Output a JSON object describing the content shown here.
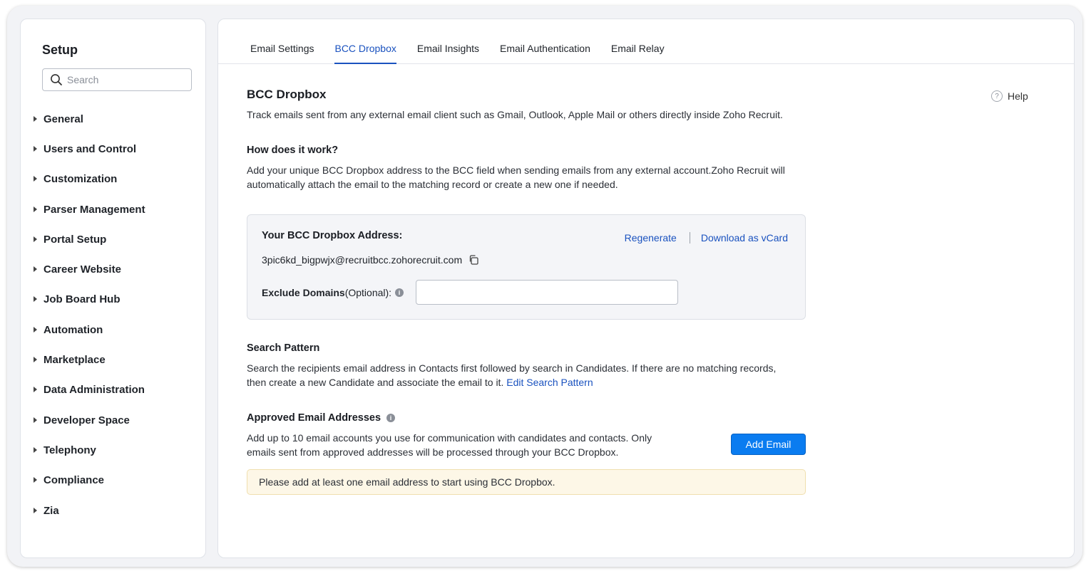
{
  "sidebar": {
    "title": "Setup",
    "search_placeholder": "Search",
    "items": [
      {
        "label": "General"
      },
      {
        "label": "Users and Control"
      },
      {
        "label": "Customization"
      },
      {
        "label": "Parser Management"
      },
      {
        "label": "Portal Setup"
      },
      {
        "label": "Career Website"
      },
      {
        "label": "Job Board Hub"
      },
      {
        "label": "Automation"
      },
      {
        "label": "Marketplace"
      },
      {
        "label": "Data Administration"
      },
      {
        "label": "Developer Space"
      },
      {
        "label": "Telephony"
      },
      {
        "label": "Compliance"
      },
      {
        "label": "Zia"
      }
    ]
  },
  "tabs": [
    {
      "label": "Email Settings",
      "active": false
    },
    {
      "label": "BCC Dropbox",
      "active": true
    },
    {
      "label": "Email Insights",
      "active": false
    },
    {
      "label": "Email Authentication",
      "active": false
    },
    {
      "label": "Email Relay",
      "active": false
    }
  ],
  "page": {
    "title": "BCC Dropbox",
    "help_label": "Help",
    "description": "Track emails sent from any external email client such as Gmail, Outlook, Apple Mail or others directly inside Zoho Recruit.",
    "how_title": "How does it work?",
    "how_text_1": "Add your unique BCC Dropbox address to the BCC field when sending emails from any external account.Zoho Recruit will",
    "how_text_2": "automatically attach the email to the matching record or create a new one if needed."
  },
  "card": {
    "label": "Your BCC Dropbox Address:",
    "regenerate": "Regenerate",
    "download_vcard": "Download as vCard",
    "address": "3pic6kd_bigpwjx@recruitbcc.zohorecruit.com",
    "exclude_label": "Exclude Domains",
    "exclude_optional": " (Optional):",
    "exclude_value": ""
  },
  "search_pattern": {
    "title": "Search Pattern",
    "text_1": "Search the recipients email address in Contacts first followed by search in Candidates. If there are no matching records,",
    "text_2": "then create a new Candidate and associate the email to it.",
    "edit_link": "Edit Search Pattern"
  },
  "approved": {
    "title": "Approved Email Addresses",
    "text_1": "Add up to 10 email accounts you use for communication with candidates and contacts. Only",
    "text_2": "emails sent from approved addresses will be processed through your BCC Dropbox.",
    "button": "Add Email",
    "notice": "Please add at least one email address to start using BCC Dropbox."
  },
  "colors": {
    "accent": "#1a52bf",
    "button": "#0a7cf0",
    "notice_bg": "#fdf7e7"
  }
}
